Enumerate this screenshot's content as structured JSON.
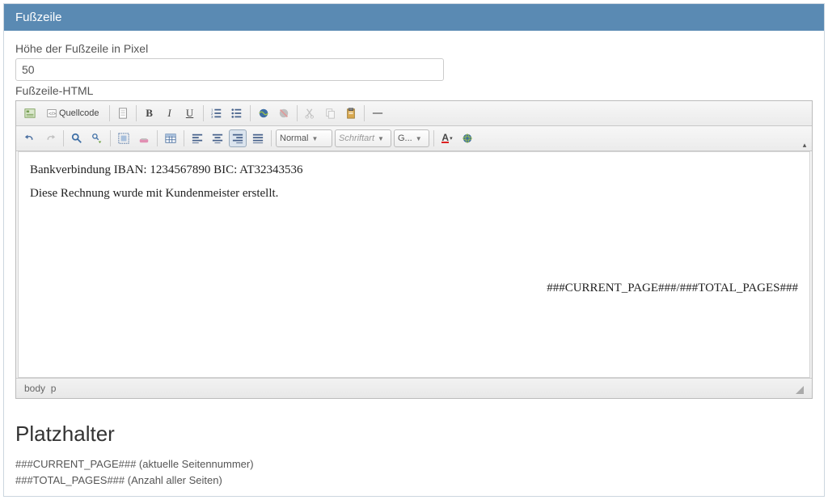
{
  "panel": {
    "title": "Fußzeile"
  },
  "form": {
    "height_label": "Höhe der Fußzeile in Pixel",
    "height_value": "50",
    "html_label": "Fußzeile-HTML"
  },
  "toolbar": {
    "source_label": "Quellcode",
    "format_select": "Normal",
    "font_select": "Schriftart",
    "size_select": "G..."
  },
  "content": {
    "line1": "Bankverbindung IBAN: 1234567890 BIC: AT32343536",
    "line2": "Diese Rechnung wurde mit Kundenmeister erstellt.",
    "pager": "###CURRENT_PAGE###/###TOTAL_PAGES###"
  },
  "pathbar": {
    "path1": "body",
    "path2": "p"
  },
  "section": {
    "heading": "Platzhalter",
    "ph1": "###CURRENT_PAGE### (aktuelle Seitennummer)",
    "ph2": "###TOTAL_PAGES### (Anzahl aller Seiten)"
  }
}
